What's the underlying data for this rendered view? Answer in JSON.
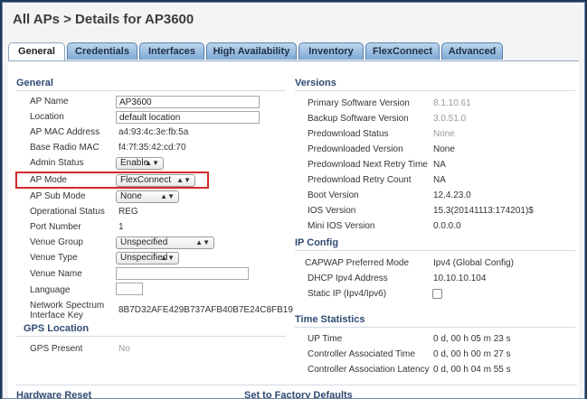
{
  "page": {
    "title": "All APs > Details for AP3600"
  },
  "tabs": [
    "General",
    "Credentials",
    "Interfaces",
    "High Availability",
    "Inventory",
    "FlexConnect",
    "Advanced"
  ],
  "general": {
    "heading": "General",
    "ap_name": {
      "label": "AP Name",
      "value": "AP3600"
    },
    "location": {
      "label": "Location",
      "value": "default location"
    },
    "ap_mac": {
      "label": "AP MAC Address",
      "value": "a4:93:4c:3e:fb:5a"
    },
    "base_radio_mac": {
      "label": "Base Radio MAC",
      "value": "f4:7f:35:42:cd:70"
    },
    "admin_status": {
      "label": "Admin Status",
      "value": "Enable"
    },
    "ap_mode": {
      "label": "AP Mode",
      "value": "FlexConnect"
    },
    "ap_sub_mode": {
      "label": "AP Sub Mode",
      "value": "None"
    },
    "operational_status": {
      "label": "Operational Status",
      "value": "REG"
    },
    "port_number": {
      "label": "Port Number",
      "value": "1"
    },
    "venue_group": {
      "label": "Venue Group",
      "value": "Unspecified"
    },
    "venue_type": {
      "label": "Venue Type",
      "value": "Unspecified"
    },
    "venue_name": {
      "label": "Venue Name",
      "value": ""
    },
    "language": {
      "label": "Language",
      "value": ""
    },
    "network_spectrum": {
      "label_line1": "Network Spectrum",
      "label_line2": "Interface Key",
      "value": "8B7D32AFE429B737AFB40B7E24C8FB19"
    }
  },
  "gps": {
    "heading": "GPS Location",
    "present_label": "GPS Present",
    "present_value": "No"
  },
  "versions": {
    "heading": "Versions",
    "primary": {
      "label": "Primary Software Version",
      "value": "8.1.10.61"
    },
    "backup": {
      "label": "Backup Software Version",
      "value": "3.0.51.0"
    },
    "predownload_status": {
      "label": "Predownload Status",
      "value": "None"
    },
    "predownloaded_version": {
      "label": "Predownloaded Version",
      "value": "None"
    },
    "next_retry_time": {
      "label": "Predownload Next Retry Time",
      "value": "NA"
    },
    "retry_count": {
      "label": "Predownload Retry Count",
      "value": "NA"
    },
    "boot": {
      "label": "Boot Version",
      "value": "12.4.23.0"
    },
    "ios": {
      "label": "IOS Version",
      "value": "15.3(20141113:174201)$"
    },
    "mini_ios": {
      "label": "Mini IOS Version",
      "value": "0.0.0.0"
    }
  },
  "ip_config": {
    "heading": "IP Config",
    "capwap_mode": {
      "label": "CAPWAP Preferred Mode",
      "value": "Ipv4 (Global Config)"
    },
    "dhcp": {
      "label": "DHCP Ipv4 Address",
      "value": "10.10.10.104"
    },
    "static_ip": {
      "label": "Static IP (Ipv4/Ipv6)"
    }
  },
  "time_stats": {
    "heading": "Time Statistics",
    "up_time": {
      "label": "UP Time",
      "value": "0 d, 00 h 05 m 23 s"
    },
    "assoc_time": {
      "label": "Controller Associated Time",
      "value": "0 d, 00 h 00 m 27 s"
    },
    "assoc_latency": {
      "label": "Controller Association Latency",
      "value": "0 d, 00 h 04 m 55 s"
    }
  },
  "footer": {
    "hardware_reset": "Hardware Reset",
    "factory_defaults": "Set to Factory Defaults"
  },
  "colors": {
    "tab_blue": "#7fa8d3",
    "section_heading": "#2f4b73",
    "highlight": "#d12a2a"
  }
}
